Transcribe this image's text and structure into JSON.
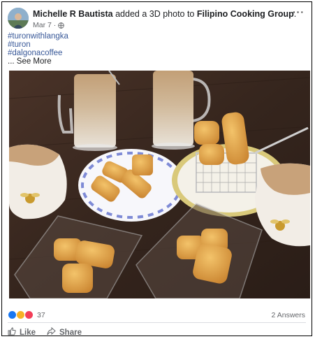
{
  "post": {
    "author": "Michelle R Bautista",
    "action_text": " added a 3D photo to ",
    "group": "Filipino Cooking Group",
    "group_suffix": ".",
    "date": "Mar 7 ·",
    "more_label": "···"
  },
  "hashtags": [
    "#turonwithlangka",
    "#turon",
    "#dalgonacoffee"
  ],
  "see_more": "... See More",
  "reactions": {
    "count": "37",
    "types": [
      "like",
      "wow",
      "love"
    ],
    "colors": [
      "#1877f2",
      "#f7b125",
      "#f33e58"
    ]
  },
  "answers_label": "2 Answers",
  "actions": {
    "like_label": "Like",
    "share_label": "Share"
  },
  "colors": {
    "link": "#385898",
    "meta": "#65676b",
    "table": "#3a2a22"
  }
}
